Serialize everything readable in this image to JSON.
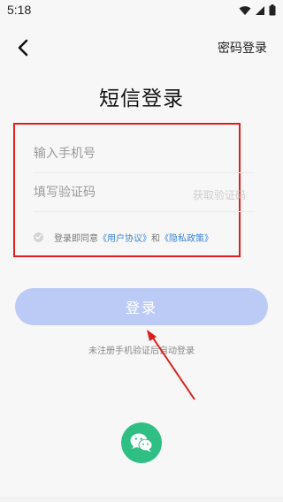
{
  "status_bar": {
    "time": "5:18"
  },
  "nav": {
    "password_login": "密码登录"
  },
  "title": "短信登录",
  "form": {
    "phone_placeholder": "输入手机号",
    "code_placeholder": "填写验证码",
    "get_code": "获取验证码"
  },
  "agreement": {
    "prefix": "登录即同意",
    "user_agreement": "《用户协议》",
    "and": "和",
    "privacy_policy": "《隐私政策》"
  },
  "login_button": "登录",
  "hint": "未注册手机验证后自动登录",
  "colors": {
    "accent": "#bccbf6",
    "link": "#3a86d8",
    "highlight": "#e02020",
    "wechat": "#2fbf85"
  },
  "icons": {
    "back": "chevron-left-icon",
    "wechat": "wechat-icon",
    "check": "check-icon"
  }
}
